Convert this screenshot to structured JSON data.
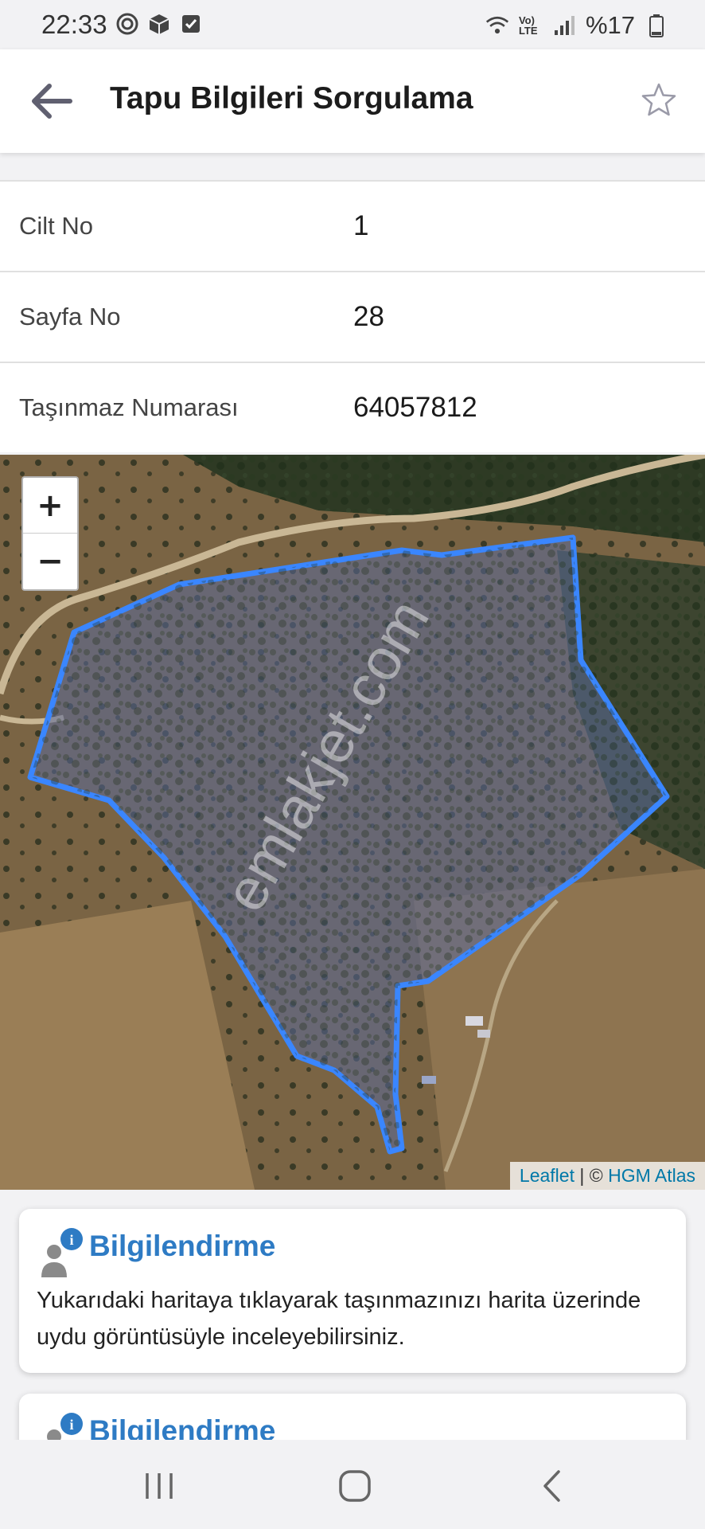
{
  "status": {
    "time": "22:33",
    "battery": "%17",
    "network": "Vo) LTE"
  },
  "app_bar": {
    "title": "Tapu Bilgileri Sorgulama"
  },
  "info_rows": [
    {
      "label": "Cilt No",
      "value": "1"
    },
    {
      "label": "Sayfa No",
      "value": "28"
    },
    {
      "label": "Taşınmaz Numarası",
      "value": "64057812"
    }
  ],
  "map": {
    "zoom_in": "+",
    "zoom_out": "−",
    "watermark": "emlakjet.com",
    "attribution_leaflet": "Leaflet",
    "attribution_sep": " | © ",
    "attribution_source": "HGM Atlas",
    "parcel_color": "#3a86ff"
  },
  "cards": [
    {
      "title": "Bilgilendirme",
      "body": "Yukarıdaki haritaya tıklayarak taşınmazınızı harita üzerinde uydu görüntüsüyle inceleyebilirsiniz.",
      "icon": "user-info-icon"
    },
    {
      "title": "Bilgilendirme",
      "icon": "user-info-icon"
    }
  ],
  "colors": {
    "accent": "#2e7bc4",
    "background": "#f2f2f4"
  }
}
